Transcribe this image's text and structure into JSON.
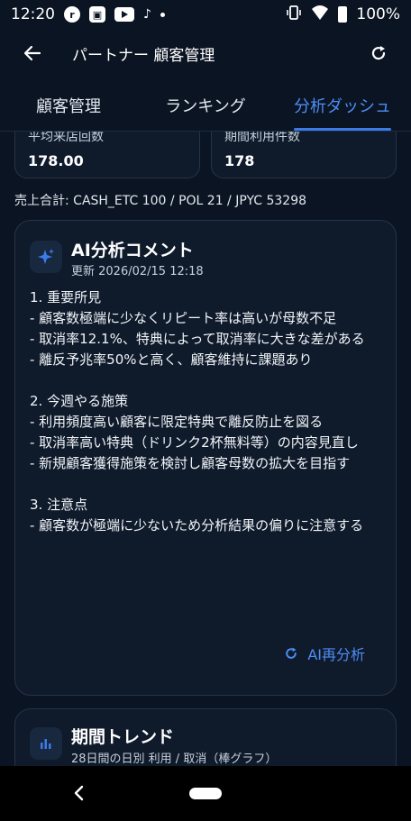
{
  "status_bar": {
    "time": "12:20",
    "battery": "100%",
    "icons": [
      "notification-app-icon",
      "notification-app-icon-2",
      "youtube-icon",
      "tiktok-icon",
      "more-notifications-dot",
      "vibrate-icon",
      "wifi-icon",
      "battery-icon"
    ]
  },
  "app_bar": {
    "title": "パートナー 顧客管理"
  },
  "tabs": [
    {
      "label": "顧客管理",
      "active": false
    },
    {
      "label": "ランキング",
      "active": false
    },
    {
      "label": "分析ダッシュ",
      "active": true
    }
  ],
  "stats": {
    "avg_visits": {
      "label": "平均来店回数",
      "value": "178.00"
    },
    "period_usage": {
      "label": "期間利用件数",
      "value": "178"
    }
  },
  "sales_total": "売上合計: CASH_ETC 100 / POL 21 / JPYC 53298",
  "ai_card": {
    "title": "AI分析コメント",
    "updated": "更新 2026/02/15 12:18",
    "body": "1. 重要所見\n- 顧客数極端に少なくリピート率は高いが母数不足\n- 取消率12.1%、特典によって取消率に大きな差がある\n- 離反予兆率50%と高く、顧客維持に課題あり\n\n2. 今週やる施策\n- 利用頻度高い顧客に限定特典で離反防止を図る\n- 取消率高い特典（ドリンク2杯無料等）の内容見直し\n- 新規顧客獲得施策を検討し顧客母数の拡大を目指す\n\n3. 注意点\n- 顧客数が極端に少ないため分析結果の偏りに注意する",
    "reanalyze_label": "AI再分析"
  },
  "trend_card": {
    "title": "期間トレンド",
    "subtitle": "28日間の日別 利用 / 取消（棒グラフ）"
  },
  "colors": {
    "background": "#0b1422",
    "card": "#0f1a2b",
    "accent": "#4d8df6"
  }
}
